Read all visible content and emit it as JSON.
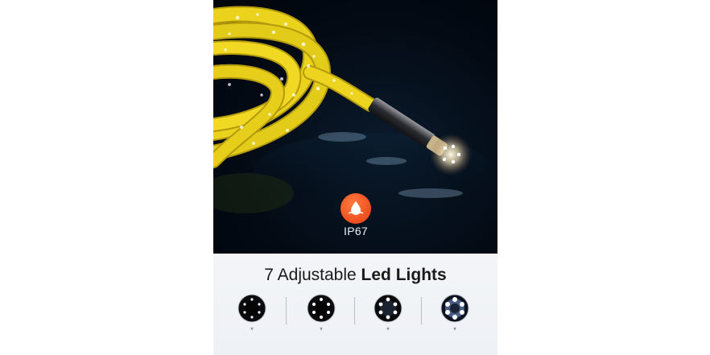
{
  "badge": {
    "icon": "water-drop-icon",
    "label": "IP67",
    "color": "#f04e1f"
  },
  "panel": {
    "title_regular": "7 Adjustable ",
    "title_bold": "Led Lights",
    "levels": [
      {
        "caption": "*",
        "brightness": 0.25
      },
      {
        "caption": "*",
        "brightness": 0.5
      },
      {
        "caption": "*",
        "brightness": 0.75
      },
      {
        "caption": "*",
        "brightness": 1.0
      }
    ]
  },
  "colors": {
    "cable": "#e9d21e",
    "background_dark": "#030a14",
    "panel_bg": "#f0f3f6"
  }
}
